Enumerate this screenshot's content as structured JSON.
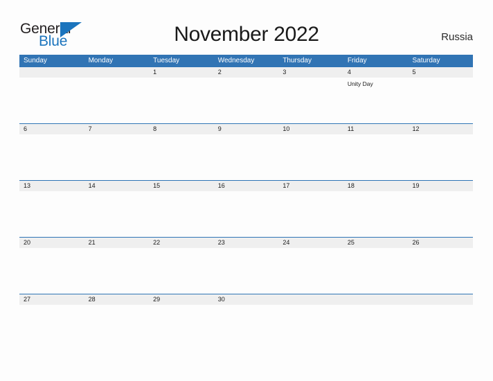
{
  "brand": {
    "name_part1": "General",
    "name_part2": "Blue",
    "flag_icon": "triangle-flag-icon",
    "color_dark": "#231f20",
    "color_blue": "#1b74bd"
  },
  "header": {
    "title": "November 2022",
    "locale": "Russia"
  },
  "theme": {
    "header_bar": "#3174b4",
    "date_band": "#efefef",
    "row_rule": "#2e74b5",
    "page_background": "#fdfdfd"
  },
  "calendar": {
    "month": "November",
    "year": "2022",
    "weekdays": [
      "Sunday",
      "Monday",
      "Tuesday",
      "Wednesday",
      "Thursday",
      "Friday",
      "Saturday"
    ],
    "weeks": [
      {
        "days": [
          {
            "date": "",
            "events": []
          },
          {
            "date": "",
            "events": []
          },
          {
            "date": "1",
            "events": []
          },
          {
            "date": "2",
            "events": []
          },
          {
            "date": "3",
            "events": []
          },
          {
            "date": "4",
            "events": [
              "Unity Day"
            ]
          },
          {
            "date": "5",
            "events": []
          }
        ]
      },
      {
        "days": [
          {
            "date": "6",
            "events": []
          },
          {
            "date": "7",
            "events": []
          },
          {
            "date": "8",
            "events": []
          },
          {
            "date": "9",
            "events": []
          },
          {
            "date": "10",
            "events": []
          },
          {
            "date": "11",
            "events": []
          },
          {
            "date": "12",
            "events": []
          }
        ]
      },
      {
        "days": [
          {
            "date": "13",
            "events": []
          },
          {
            "date": "14",
            "events": []
          },
          {
            "date": "15",
            "events": []
          },
          {
            "date": "16",
            "events": []
          },
          {
            "date": "17",
            "events": []
          },
          {
            "date": "18",
            "events": []
          },
          {
            "date": "19",
            "events": []
          }
        ]
      },
      {
        "days": [
          {
            "date": "20",
            "events": []
          },
          {
            "date": "21",
            "events": []
          },
          {
            "date": "22",
            "events": []
          },
          {
            "date": "23",
            "events": []
          },
          {
            "date": "24",
            "events": []
          },
          {
            "date": "25",
            "events": []
          },
          {
            "date": "26",
            "events": []
          }
        ]
      },
      {
        "days": [
          {
            "date": "27",
            "events": []
          },
          {
            "date": "28",
            "events": []
          },
          {
            "date": "29",
            "events": []
          },
          {
            "date": "30",
            "events": []
          },
          {
            "date": "",
            "events": []
          },
          {
            "date": "",
            "events": []
          },
          {
            "date": "",
            "events": []
          }
        ]
      }
    ]
  }
}
